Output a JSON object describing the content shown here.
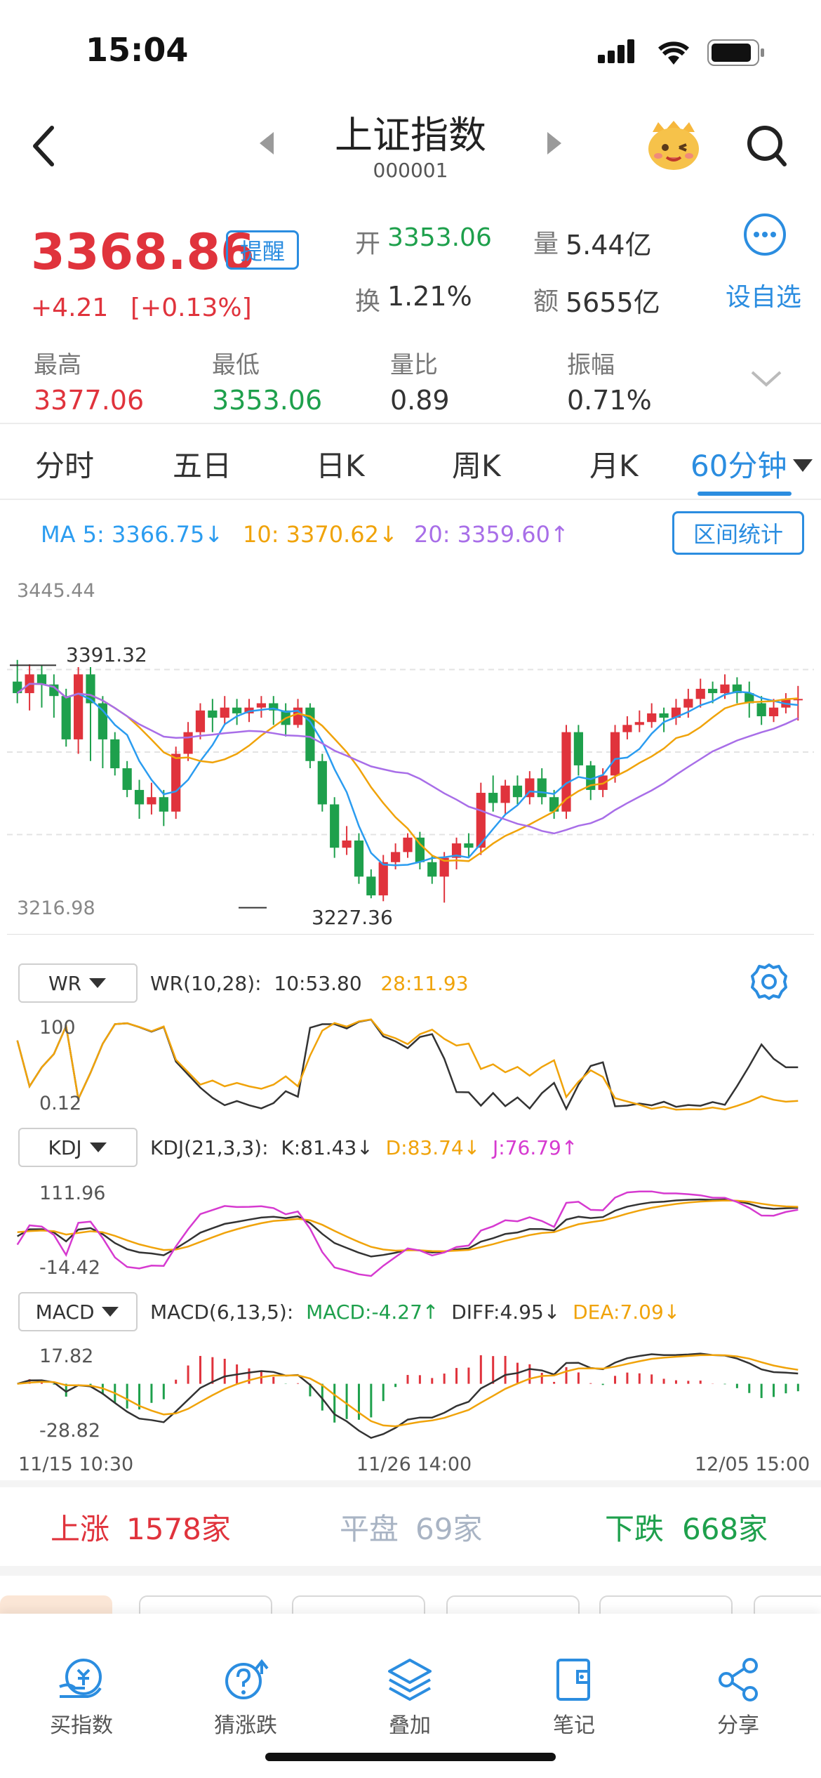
{
  "status_bar": {
    "time": "15:04"
  },
  "header": {
    "title": "上证指数",
    "code": "000001"
  },
  "quote": {
    "price": "3368.86",
    "remind_label": "提醒",
    "change": "+4.21",
    "change_pct": "[+0.13%]",
    "open_label": "开",
    "open": "3353.06",
    "volume_label": "量",
    "volume": "5.44亿",
    "turnover_label": "换",
    "turnover": "1.21%",
    "amount_label": "额",
    "amount": "5655亿",
    "watchlist_label": "设自选",
    "high_label": "最高",
    "high": "3377.06",
    "low_label": "最低",
    "low": "3353.06",
    "vol_ratio_label": "量比",
    "vol_ratio": "0.89",
    "amplitude_label": "振幅",
    "amplitude": "0.71%"
  },
  "tabs": [
    "分时",
    "五日",
    "日K",
    "周K",
    "月K",
    "60分钟"
  ],
  "ma": {
    "ma5": "MA 5: 3366.75↓",
    "ma10": "10: 3370.62↓",
    "ma20": "20: 3359.60↑",
    "range_stats_label": "区间统计"
  },
  "kline_labels": {
    "top": "3445.44",
    "bottom": "3216.98",
    "high_mark": "3391.32",
    "low_mark": "3227.36"
  },
  "wr": {
    "name": "WR",
    "params": "WR(10,28):",
    "v1": "10:53.80",
    "v2": "28:11.93",
    "top": "100",
    "bottom": "0.12"
  },
  "kdj": {
    "name": "KDJ",
    "params": "KDJ(21,3,3):",
    "k": "K:81.43↓",
    "d": "D:83.74↓",
    "j": "J:76.79↑",
    "top": "111.96",
    "bottom": "-14.42"
  },
  "macd": {
    "name": "MACD",
    "params": "MACD(6,13,5):",
    "macd": "MACD:-4.27↑",
    "diff": "DIFF:4.95↓",
    "dea": "DEA:7.09↓",
    "top": "17.82",
    "bottom": "-28.82"
  },
  "x_axis": {
    "start": "11/15 10:30",
    "mid": "11/26 14:00",
    "end": "12/05 15:00"
  },
  "breadth": {
    "up_label": "上涨",
    "up_count": "1578家",
    "flat_label": "平盘",
    "flat_count": "69家",
    "down_label": "下跌",
    "down_count": "668家"
  },
  "bottom_nav": [
    {
      "label": "买指数",
      "icon": "buy-index-icon"
    },
    {
      "label": "猜涨跌",
      "icon": "guess-icon"
    },
    {
      "label": "叠加",
      "icon": "layers-icon"
    },
    {
      "label": "笔记",
      "icon": "note-icon"
    },
    {
      "label": "分享",
      "icon": "share-icon"
    }
  ],
  "colors": {
    "up": "#e0333c",
    "down": "#1ea04c",
    "accent": "#2b8de0",
    "ma5": "#2b9cf0",
    "ma10": "#f0a30a",
    "ma20": "#a86ee8"
  },
  "chart_data": {
    "type": "candlestick",
    "ylim": [
      3216.98,
      3445.44
    ],
    "candles": [
      [
        3380,
        3372,
        3395,
        3365
      ],
      [
        3372,
        3385,
        3392,
        3360
      ],
      [
        3385,
        3378,
        3391,
        3362
      ],
      [
        3378,
        3370,
        3385,
        3355
      ],
      [
        3370,
        3340,
        3375,
        3335
      ],
      [
        3340,
        3385,
        3390,
        3330
      ],
      [
        3385,
        3365,
        3390,
        3325
      ],
      [
        3365,
        3340,
        3370,
        3320
      ],
      [
        3340,
        3320,
        3345,
        3315
      ],
      [
        3320,
        3305,
        3325,
        3300
      ],
      [
        3305,
        3295,
        3312,
        3285
      ],
      [
        3295,
        3300,
        3310,
        3288
      ],
      [
        3300,
        3290,
        3305,
        3280
      ],
      [
        3290,
        3330,
        3335,
        3285
      ],
      [
        3330,
        3345,
        3352,
        3325
      ],
      [
        3345,
        3360,
        3365,
        3340
      ],
      [
        3360,
        3355,
        3368,
        3345
      ],
      [
        3355,
        3362,
        3370,
        3350
      ],
      [
        3362,
        3358,
        3368,
        3350
      ],
      [
        3358,
        3362,
        3368,
        3352
      ],
      [
        3362,
        3365,
        3370,
        3355
      ],
      [
        3365,
        3360,
        3370,
        3350
      ],
      [
        3360,
        3350,
        3365,
        3342
      ],
      [
        3350,
        3362,
        3368,
        3348
      ],
      [
        3362,
        3325,
        3365,
        3320
      ],
      [
        3325,
        3295,
        3330,
        3290
      ],
      [
        3295,
        3265,
        3300,
        3258
      ],
      [
        3265,
        3270,
        3280,
        3260
      ],
      [
        3270,
        3245,
        3275,
        3240
      ],
      [
        3245,
        3232,
        3250,
        3230
      ],
      [
        3232,
        3255,
        3260,
        3228
      ],
      [
        3255,
        3262,
        3268,
        3250
      ],
      [
        3262,
        3272,
        3275,
        3258
      ],
      [
        3272,
        3255,
        3276,
        3250
      ],
      [
        3255,
        3245,
        3260,
        3240
      ],
      [
        3245,
        3258,
        3262,
        3227
      ],
      [
        3258,
        3268,
        3272,
        3250
      ],
      [
        3268,
        3265,
        3275,
        3258
      ],
      [
        3265,
        3303,
        3310,
        3260
      ],
      [
        3303,
        3296,
        3315,
        3290
      ],
      [
        3296,
        3308,
        3312,
        3288
      ],
      [
        3308,
        3300,
        3315,
        3295
      ],
      [
        3300,
        3313,
        3318,
        3295
      ],
      [
        3313,
        3300,
        3320,
        3295
      ],
      [
        3300,
        3290,
        3305,
        3285
      ],
      [
        3290,
        3345,
        3350,
        3285
      ],
      [
        3345,
        3322,
        3350,
        3315
      ],
      [
        3322,
        3305,
        3325,
        3298
      ],
      [
        3305,
        3315,
        3320,
        3300
      ],
      [
        3315,
        3345,
        3350,
        3310
      ],
      [
        3345,
        3350,
        3356,
        3340
      ],
      [
        3350,
        3352,
        3360,
        3345
      ],
      [
        3352,
        3358,
        3365,
        3348
      ],
      [
        3358,
        3355,
        3362,
        3345
      ],
      [
        3355,
        3362,
        3368,
        3350
      ],
      [
        3362,
        3368,
        3375,
        3355
      ],
      [
        3368,
        3375,
        3382,
        3362
      ],
      [
        3375,
        3372,
        3380,
        3365
      ],
      [
        3372,
        3378,
        3385,
        3368
      ],
      [
        3378,
        3372,
        3383,
        3365
      ],
      [
        3372,
        3365,
        3380,
        3355
      ],
      [
        3365,
        3356,
        3370,
        3350
      ],
      [
        3356,
        3362,
        3368,
        3352
      ],
      [
        3362,
        3368,
        3372,
        3358
      ],
      [
        3368,
        3368,
        3377,
        3353
      ]
    ]
  }
}
